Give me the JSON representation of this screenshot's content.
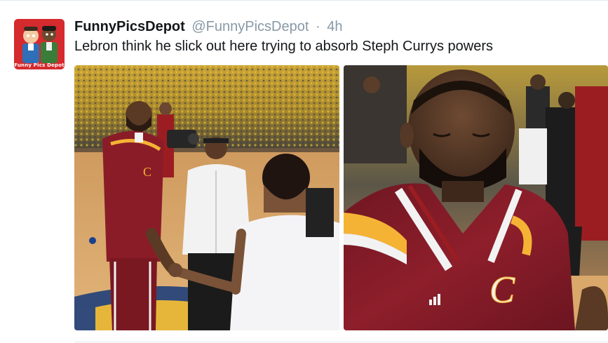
{
  "tweet": {
    "display_name": "FunnyPicsDepot",
    "handle": "@FunnyPicsDepot",
    "separator": "·",
    "timestamp": "4h",
    "text": "Lebron think he slick out here trying to absorb Steph Currys powers",
    "avatar_label": "Funny Pics Depot"
  },
  "media": [
    {
      "name": "handshake-photo",
      "jersey_letter": "C"
    },
    {
      "name": "lebron-closeup-photo",
      "jersey_letter": "C",
      "brand_mark": "adidas"
    }
  ],
  "colors": {
    "cavs_wine": "#8a1c28",
    "cavs_gold": "#f5b335",
    "warriors_gold": "#e8b923",
    "court": "#d9a86a",
    "name_text": "#14171a",
    "meta_text": "#8899a6"
  }
}
